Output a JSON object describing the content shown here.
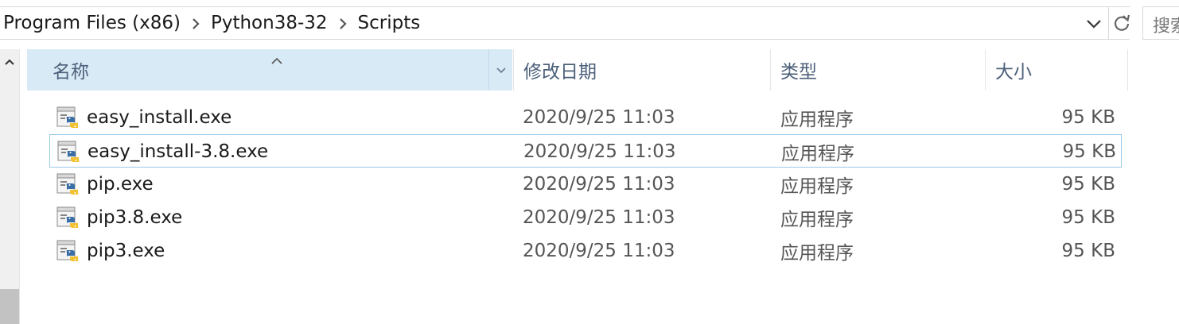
{
  "address": {
    "crumbs": [
      "Program Files (x86)",
      "Python38-32",
      "Scripts"
    ]
  },
  "search": {
    "placeholder": "搜索"
  },
  "columns": {
    "name": "名称",
    "date": "修改日期",
    "type": "类型",
    "size": "大小"
  },
  "files": [
    {
      "name": "easy_install.exe",
      "date": "2020/9/25 11:03",
      "type": "应用程序",
      "size": "95 KB"
    },
    {
      "name": "easy_install-3.8.exe",
      "date": "2020/9/25 11:03",
      "type": "应用程序",
      "size": "95 KB"
    },
    {
      "name": "pip.exe",
      "date": "2020/9/25 11:03",
      "type": "应用程序",
      "size": "95 KB"
    },
    {
      "name": "pip3.8.exe",
      "date": "2020/9/25 11:03",
      "type": "应用程序",
      "size": "95 KB"
    },
    {
      "name": "pip3.exe",
      "date": "2020/9/25 11:03",
      "type": "应用程序",
      "size": "95 KB"
    }
  ],
  "selected_index": 1,
  "colors": {
    "header_bg": "#d9eaf7",
    "selection_border": "#99c9e6",
    "header_text": "#4c607a"
  },
  "icons": {
    "file": "python-exe-icon",
    "refresh": "refresh-icon",
    "dropdown": "chevron-down-icon"
  }
}
